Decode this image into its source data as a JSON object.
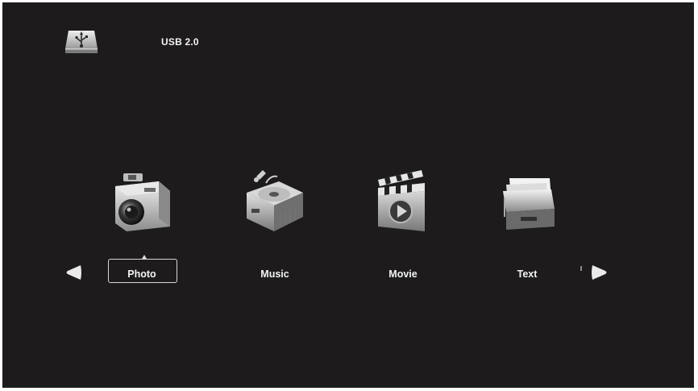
{
  "source": {
    "label": "USB 2.0",
    "icon": "usb-drive-icon"
  },
  "media_menu": {
    "selected": "Photo",
    "items": [
      {
        "label": "Photo",
        "icon": "camera-icon"
      },
      {
        "label": "Music",
        "icon": "music-player-icon"
      },
      {
        "label": "Movie",
        "icon": "clapperboard-icon"
      },
      {
        "label": "Text",
        "icon": "document-tray-icon"
      }
    ]
  },
  "navigation": {
    "prev_icon": "arrow-left-icon",
    "next_icon": "arrow-right-icon"
  },
  "colors": {
    "background": "#1d1b1b",
    "text": "#f4f4f4",
    "selection_border": "#d8d8d8"
  }
}
